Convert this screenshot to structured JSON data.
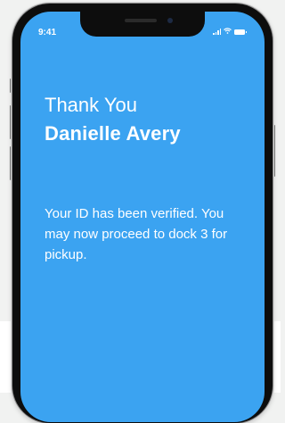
{
  "status_bar": {
    "time": "9:41",
    "icons": [
      "signal-icon",
      "wifi-icon",
      "battery-icon"
    ]
  },
  "screen": {
    "greeting": "Thank You",
    "name": "Danielle Avery",
    "message": "Your ID has been verified. You may now proceed to dock 3 for pickup.",
    "background_color": "#3ba3f1",
    "text_color": "#ffffff"
  }
}
